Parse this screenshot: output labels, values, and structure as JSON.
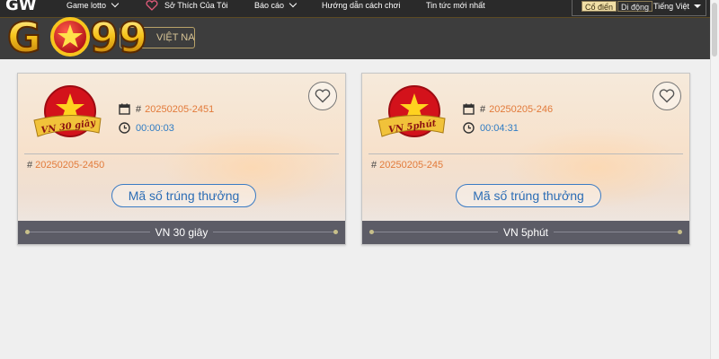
{
  "brand": {
    "prefix": "GW",
    "name": "GO99"
  },
  "nav": {
    "items": [
      {
        "label": "Game lotto",
        "has_dropdown": true
      },
      {
        "label": "Sở Thích Của Tôi",
        "icon": "heart-icon"
      },
      {
        "label": "Báo cáo",
        "has_dropdown": true
      },
      {
        "label": "Hướng dẫn cách chơi"
      },
      {
        "label": "Tin tức mới nhất"
      }
    ],
    "mode_classic": "Cổ điển",
    "mode_mobile": "Di động",
    "language": "Tiếng Việt"
  },
  "subbar": {
    "region": "VIỆT NAM"
  },
  "cards": [
    {
      "title": "VN 30 giây",
      "emblem_text": "VN 30 giây",
      "current_issue": "20250205-2451",
      "countdown": "00:00:03",
      "previous_issue": "20250205-2450",
      "result_button": "Mã số trúng thưởng"
    },
    {
      "title": "VN 5phút",
      "emblem_text": "VN 5phút",
      "current_issue": "20250205-246",
      "countdown": "00:04:31",
      "previous_issue": "20250205-245",
      "result_button": "Mã số trúng thưởng"
    }
  ],
  "symbols": {
    "hash": "#"
  },
  "colors": {
    "nav_bg": "#2a2a2a",
    "issue_number": "#e27a3a",
    "countdown": "#2f7cc4",
    "card_footer": "#5c5c66",
    "logo_gold": "#f7c51e",
    "emblem_red": "#d3121b"
  }
}
